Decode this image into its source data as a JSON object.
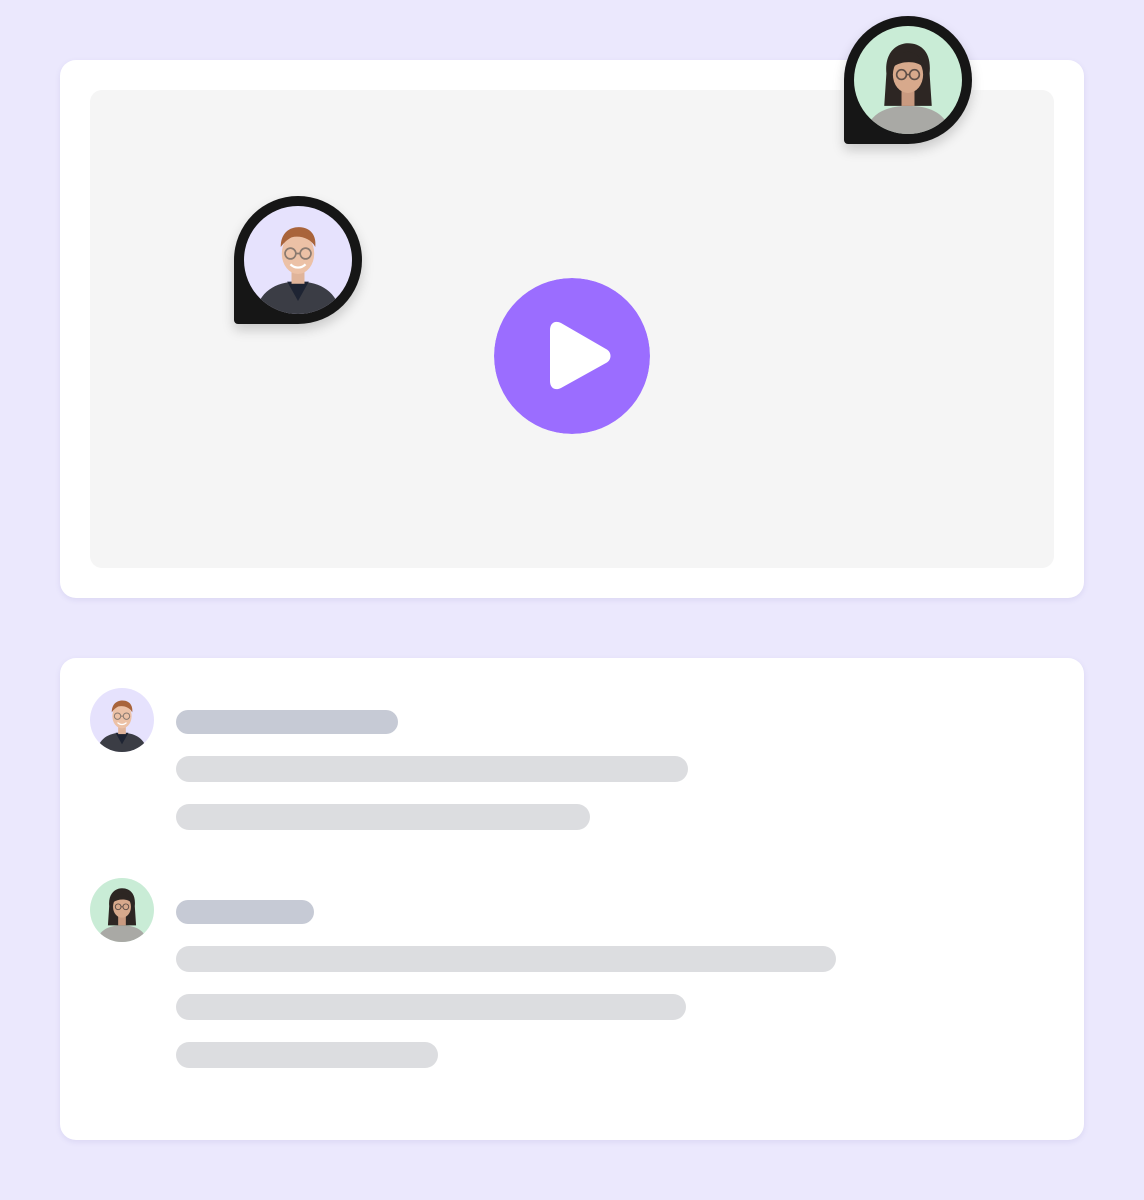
{
  "colors": {
    "page_background": "#ebe8fd",
    "card": "#ffffff",
    "video_placeholder": "#f5f5f5",
    "play_button": "#9b6dff",
    "pin": "#161616",
    "avatar_man_background": "#e6e2fd",
    "avatar_woman_background": "#c9ecd6",
    "skeleton_name": "#c6cad5",
    "skeleton_text": "#dcdde0"
  },
  "icons": {
    "play": "play-triangle-icon",
    "man": "man-with-glasses-avatar",
    "woman": "woman-with-glasses-avatar"
  },
  "video": {
    "participants": [
      "man-with-glasses",
      "woman-with-glasses"
    ]
  },
  "comments": [
    {
      "author": "man-with-glasses",
      "name_line": true,
      "text_lines": 2
    },
    {
      "author": "woman-with-glasses",
      "name_line": true,
      "text_lines": 3
    }
  ]
}
